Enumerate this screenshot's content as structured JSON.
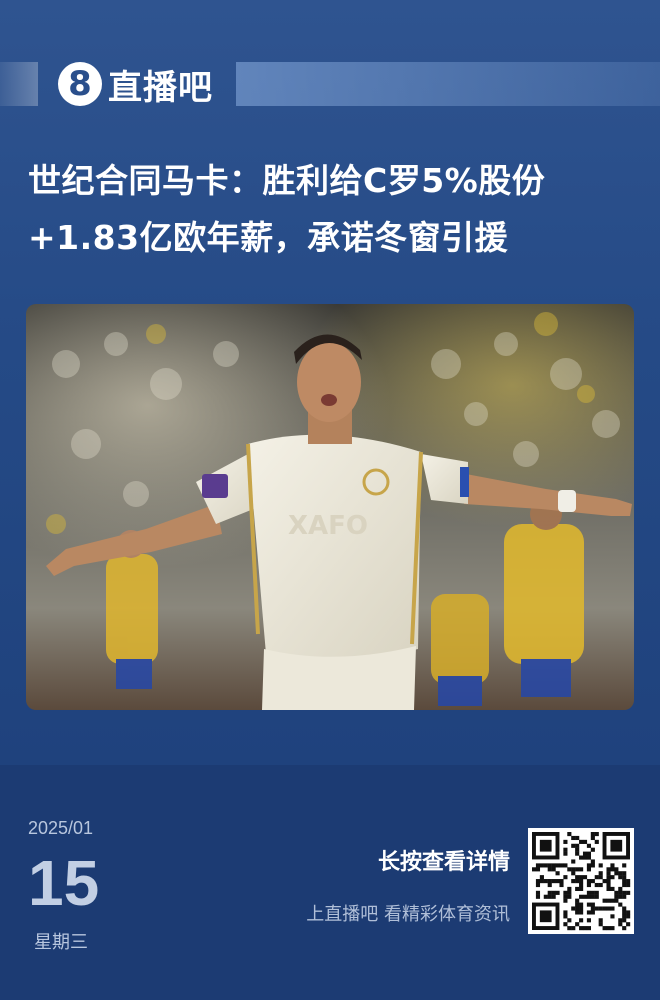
{
  "brand": {
    "logo_mark": "8",
    "name": "直播吧"
  },
  "article": {
    "headline_line1": "世纪合同马卡：胜利给C罗5%股份",
    "headline_line2": "+1.83亿欧年薪，承诺冬窗引援",
    "photo": {
      "jersey_text": "XAFO",
      "description_icon": "football-player-celebration-photo"
    }
  },
  "footer": {
    "year_month": "2025/01",
    "day": "15",
    "weekday": "星期三",
    "cta_main": "长按查看详情",
    "cta_sub": "上直播吧 看精彩体育资讯",
    "qr_icon": "qr-code-icon"
  },
  "colors": {
    "top_bg": "#2f5490",
    "bottom_bg": "#1c3b73",
    "text_primary": "#ffffff",
    "text_muted": "#b8c6de"
  }
}
